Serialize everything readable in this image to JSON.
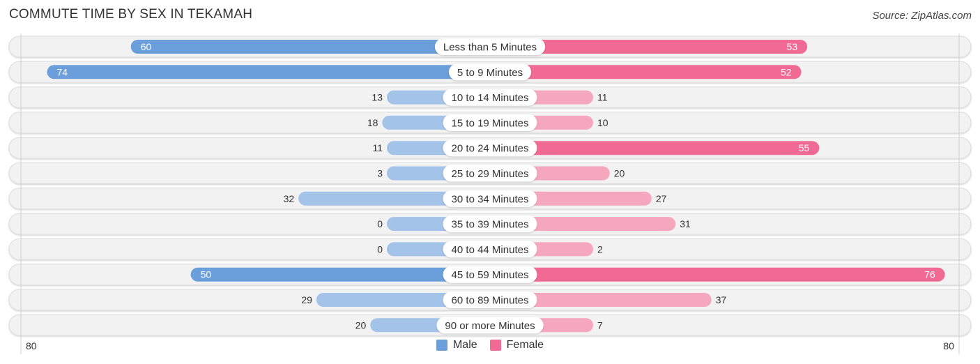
{
  "header": {
    "title": "COMMUTE TIME BY SEX IN TEKAMAH",
    "source": "Source: ZipAtlas.com"
  },
  "colors": {
    "male_strong": "#6a9fdc",
    "male_light": "#a3c3e9",
    "female_strong": "#f06a93",
    "female_light": "#f6a7c0",
    "track": "#f2f2f2"
  },
  "chart_data": {
    "type": "bar",
    "orientation": "horizontal-diverging",
    "title": "COMMUTE TIME BY SEX IN TEKAMAH",
    "categories": [
      "Less than 5 Minutes",
      "5 to 9 Minutes",
      "10 to 14 Minutes",
      "15 to 19 Minutes",
      "20 to 24 Minutes",
      "25 to 29 Minutes",
      "30 to 34 Minutes",
      "35 to 39 Minutes",
      "40 to 44 Minutes",
      "45 to 59 Minutes",
      "60 to 89 Minutes",
      "90 or more Minutes"
    ],
    "series": [
      {
        "name": "Male",
        "side": "left",
        "values": [
          60,
          74,
          13,
          18,
          11,
          3,
          32,
          0,
          0,
          50,
          29,
          20
        ]
      },
      {
        "name": "Female",
        "side": "right",
        "values": [
          53,
          52,
          11,
          10,
          55,
          20,
          27,
          31,
          2,
          76,
          37,
          7
        ]
      }
    ],
    "axis": {
      "left_max_label": "80",
      "right_max_label": "80",
      "range": [
        0,
        80
      ]
    },
    "legend": {
      "position": "bottom-center",
      "entries": [
        "Male",
        "Female"
      ]
    },
    "xlabel": "",
    "ylabel": ""
  }
}
